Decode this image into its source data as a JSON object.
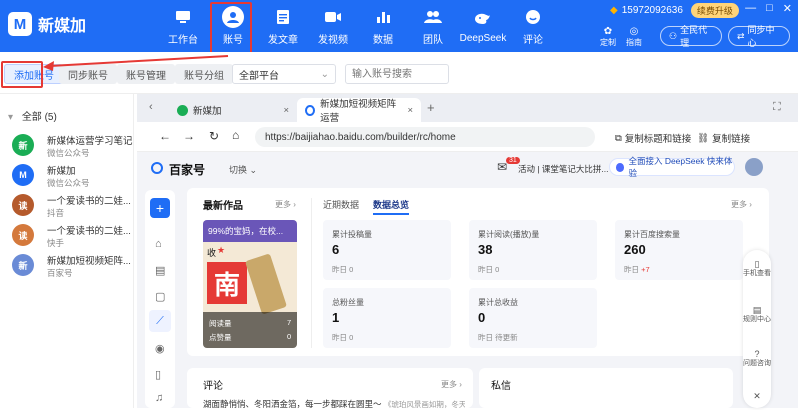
{
  "app": {
    "logo_text": "新媒加",
    "logo_mark": "M"
  },
  "nav": [
    {
      "label": "工作台",
      "icon": "monitor-icon"
    },
    {
      "label": "账号",
      "icon": "user-icon",
      "active": true
    },
    {
      "label": "发文章",
      "icon": "document-icon"
    },
    {
      "label": "发视频",
      "icon": "video-icon"
    },
    {
      "label": "数据",
      "icon": "bar-chart-icon"
    },
    {
      "label": "团队",
      "icon": "team-icon"
    },
    {
      "label": "DeepSeek",
      "icon": "deepseek-whale-icon"
    },
    {
      "label": "评论",
      "icon": "comment-icon"
    }
  ],
  "header_right": {
    "phone": "15972092636",
    "upgrade": "续费升级",
    "agent": "全民代理",
    "sync": "同步中心",
    "custom": "定制",
    "guide": "指南",
    "minimize": "—",
    "maximize": "□",
    "close": "✕"
  },
  "toolbar": {
    "add_account": "添加账号",
    "sync_account": "同步账号",
    "manage": "账号管理",
    "group": "账号分组",
    "platform_select": "全部平台",
    "search_placeholder": "输入账号搜索"
  },
  "sidebar": {
    "group_label": "全部 (5)",
    "accounts": [
      {
        "name": "新媒体运营学习笔记",
        "platform": "微信公众号",
        "color": "#1aad55",
        "initial": "新"
      },
      {
        "name": "新媒加",
        "platform": "微信公众号",
        "color": "#1f6df5",
        "initial": "M"
      },
      {
        "name": "一个爱读书的二娃...",
        "platform": "抖音",
        "color": "#b55a2c",
        "initial": "读"
      },
      {
        "name": "一个爱读书的二娃...",
        "platform": "快手",
        "color": "#d4793c",
        "initial": "读"
      },
      {
        "name": "新媒加短视频矩阵...",
        "platform": "百家号",
        "color": "#6a8bd6",
        "initial": "新"
      }
    ]
  },
  "browser": {
    "tabs": [
      {
        "title": "新媒加",
        "close": "×"
      },
      {
        "title": "新媒加短视频矩阵运营",
        "close": "×"
      }
    ],
    "new_tab": "+",
    "fullscreen": "⛶",
    "url": "https://baijiahao.baidu.com/builder/rc/home",
    "copy_title_link": "复制标题和链接",
    "copy_link": "复制链接"
  },
  "bjh": {
    "brand": "百家号",
    "switch": "切换",
    "notice_badge": "31",
    "activity": "活动 | 课堂笔记大比拼...",
    "deepseek": "全面接入 DeepSeek 快来体验",
    "latest_title": "最新作品",
    "more": "更多",
    "recent_tab": "近期数据",
    "overview_tab": "数据总览",
    "work": {
      "caption": "99%的宝妈，在校...",
      "tag": "收",
      "read_label": "阅读量",
      "read": "7",
      "like_label": "点赞量",
      "like": "0"
    },
    "stats": [
      {
        "label": "累计投稿量",
        "value": "6",
        "sub": "昨日 0"
      },
      {
        "label": "累计阅读(播放)量",
        "value": "38",
        "sub": "昨日 0"
      },
      {
        "label": "累计百度搜索量",
        "value": "260",
        "sub": "昨日",
        "delta": "+7"
      },
      {
        "label": "总粉丝量",
        "value": "1",
        "sub": "昨日 0"
      },
      {
        "label": "累计总收益",
        "value": "0",
        "sub": "昨日 待更新"
      }
    ],
    "comments_title": "评论",
    "comment_preview": "湖面静悄悄、冬阳洒金箔，每一步都踩在圆里～",
    "comment_meta": "《琥珀风景画如期，冬天...",
    "messages_title": "私信",
    "float_items": [
      "手机查看",
      "规则中心",
      "问题咨询"
    ],
    "float_close": "✕"
  }
}
